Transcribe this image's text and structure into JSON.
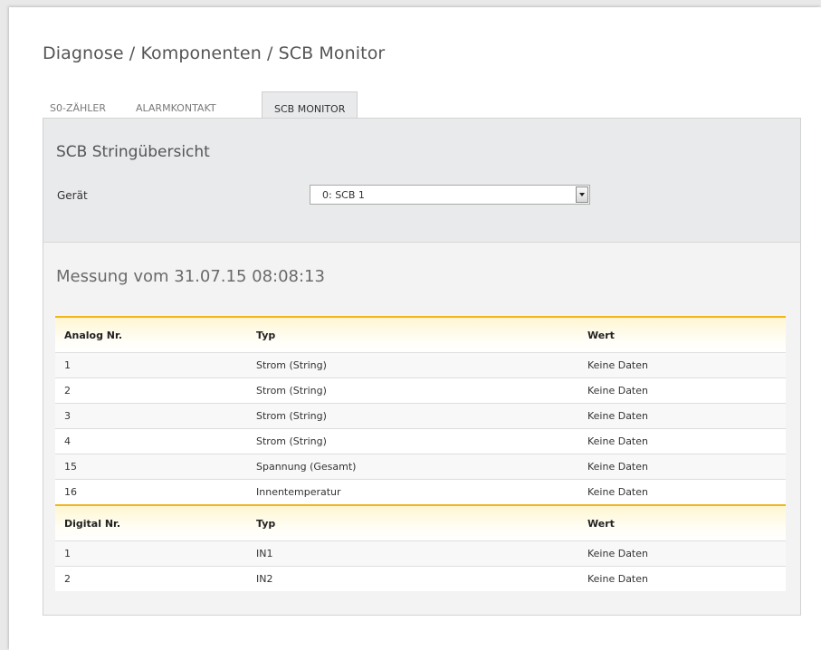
{
  "breadcrumb": "Diagnose / Komponenten / SCB Monitor",
  "tabs": [
    {
      "label": "S0-ZÄHLER",
      "active": false
    },
    {
      "label": "ALARMKONTAKT",
      "active": false
    },
    {
      "label": "SCB MONITOR",
      "active": true
    }
  ],
  "section_title": "SCB Stringübersicht",
  "geraet": {
    "label": "Gerät",
    "value": "0: SCB 1"
  },
  "measurement_title": "Messung vom 31.07.15 08:08:13",
  "analog": {
    "headers": [
      "Analog Nr.",
      "Typ",
      "Wert"
    ],
    "rows": [
      [
        "1",
        "Strom (String)",
        "Keine Daten"
      ],
      [
        "2",
        "Strom (String)",
        "Keine Daten"
      ],
      [
        "3",
        "Strom (String)",
        "Keine Daten"
      ],
      [
        "4",
        "Strom (String)",
        "Keine Daten"
      ],
      [
        "15",
        "Spannung (Gesamt)",
        "Keine Daten"
      ],
      [
        "16",
        "Innentemperatur",
        "Keine Daten"
      ]
    ]
  },
  "digital": {
    "headers": [
      "Digital Nr.",
      "Typ",
      "Wert"
    ],
    "rows": [
      [
        "1",
        "IN1",
        "Keine Daten"
      ],
      [
        "2",
        "IN2",
        "Keine Daten"
      ]
    ]
  },
  "colors": {
    "accent": "#f2b51d",
    "panel": "#e9eaec"
  }
}
